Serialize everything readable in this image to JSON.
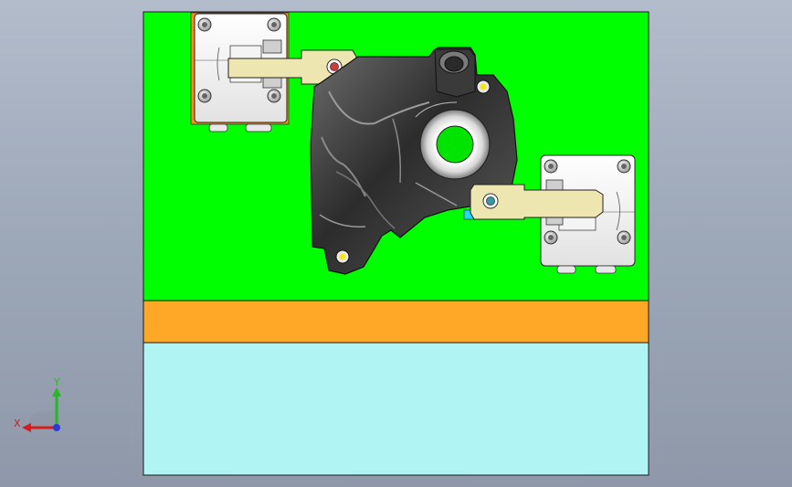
{
  "viewport": {
    "background_top": "#b3bccb",
    "background_bottom": "#8e98a9"
  },
  "fixture": {
    "base_plate_color": "#00ff00",
    "spacer_color": "#ffa726",
    "subbase_color": "#b0f4f4",
    "outline_color": "#1a1a1a"
  },
  "clamps": [
    {
      "name": "left-clamp",
      "arm_color": "#eee6b0"
    },
    {
      "name": "right-clamp",
      "arm_color": "#eee6b0"
    }
  ],
  "part": {
    "body_color": "#4a4a4a",
    "bore_color": "#00e400"
  },
  "triad": {
    "x_label": "X",
    "y_label": "Y",
    "x_color": "#d81b1b",
    "y_color": "#25b825",
    "z_color": "#2d3bd6"
  }
}
